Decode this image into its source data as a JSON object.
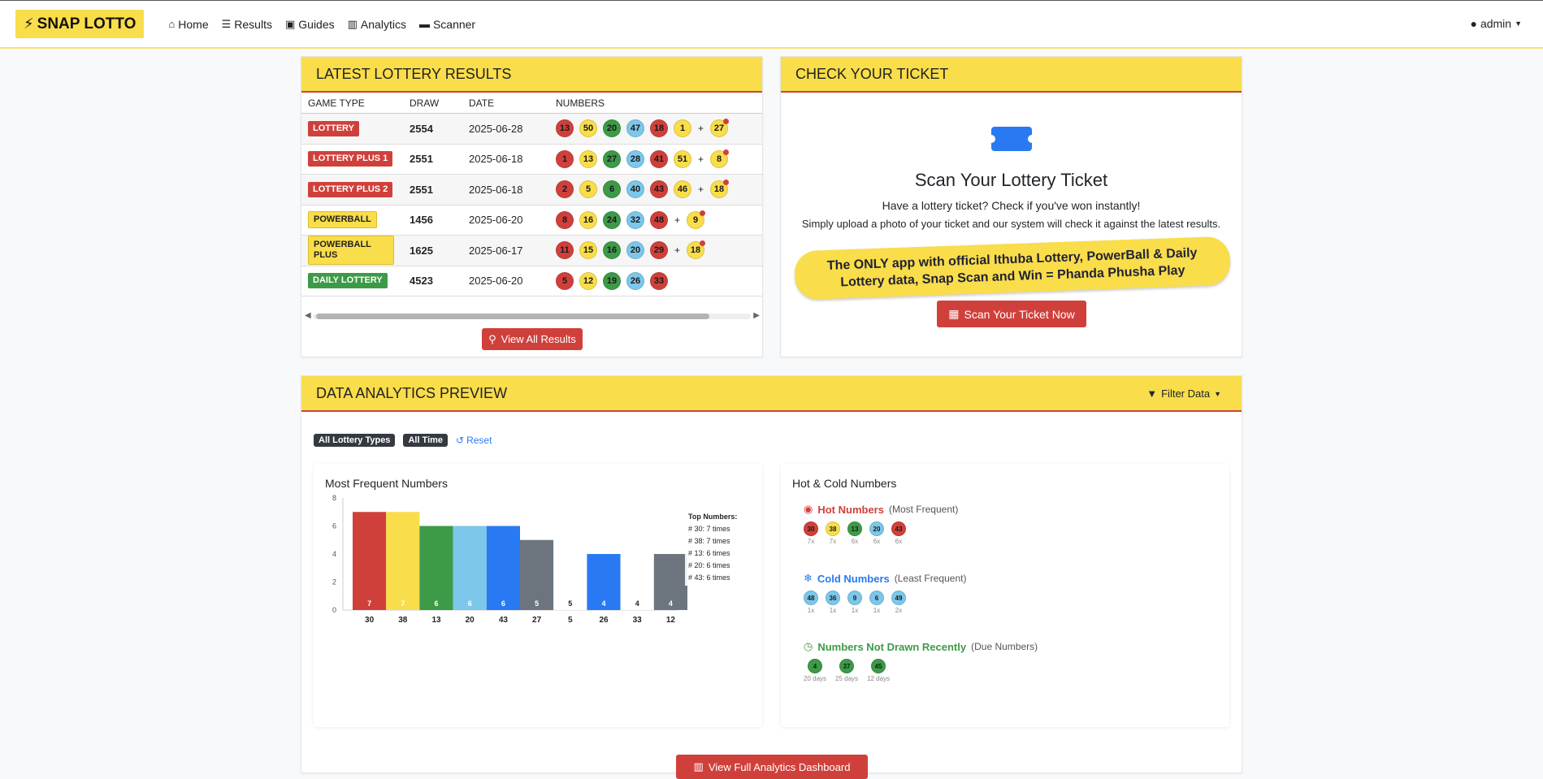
{
  "nav": {
    "brand": "SNAP LOTTO",
    "items": [
      {
        "label": "Home",
        "icon": "home-icon"
      },
      {
        "label": "Results",
        "icon": "list-icon"
      },
      {
        "label": "Guides",
        "icon": "book-icon"
      },
      {
        "label": "Analytics",
        "icon": "chart-icon"
      },
      {
        "label": "Scanner",
        "icon": "ticket-icon"
      }
    ],
    "user": "admin"
  },
  "results": {
    "title": "LATEST LOTTERY RESULTS",
    "columns": [
      "GAME TYPE",
      "DRAW",
      "DATE",
      "NUMBERS"
    ],
    "rows": [
      {
        "type": "LOTTERY",
        "badge_color": "red",
        "draw": "2554",
        "date": "2025-06-28",
        "numbers": [
          {
            "n": "13",
            "c": "red"
          },
          {
            "n": "50",
            "c": "yellow"
          },
          {
            "n": "20",
            "c": "green"
          },
          {
            "n": "47",
            "c": "blue"
          },
          {
            "n": "18",
            "c": "red"
          },
          {
            "n": "1",
            "c": "yellow"
          }
        ],
        "bonus": {
          "n": "27",
          "c": "yellow"
        }
      },
      {
        "type": "LOTTERY PLUS 1",
        "badge_color": "red",
        "draw": "2551",
        "date": "2025-06-18",
        "numbers": [
          {
            "n": "1",
            "c": "red"
          },
          {
            "n": "13",
            "c": "yellow"
          },
          {
            "n": "27",
            "c": "green"
          },
          {
            "n": "28",
            "c": "blue"
          },
          {
            "n": "41",
            "c": "red"
          },
          {
            "n": "51",
            "c": "yellow"
          }
        ],
        "bonus": {
          "n": "8",
          "c": "yellow"
        }
      },
      {
        "type": "LOTTERY PLUS 2",
        "badge_color": "red",
        "draw": "2551",
        "date": "2025-06-18",
        "numbers": [
          {
            "n": "2",
            "c": "red"
          },
          {
            "n": "5",
            "c": "yellow"
          },
          {
            "n": "6",
            "c": "green"
          },
          {
            "n": "40",
            "c": "blue"
          },
          {
            "n": "43",
            "c": "red"
          },
          {
            "n": "46",
            "c": "yellow"
          }
        ],
        "bonus": {
          "n": "18",
          "c": "yellow"
        }
      },
      {
        "type": "POWERBALL",
        "badge_color": "yellow",
        "draw": "1456",
        "date": "2025-06-20",
        "numbers": [
          {
            "n": "8",
            "c": "red"
          },
          {
            "n": "16",
            "c": "yellow"
          },
          {
            "n": "24",
            "c": "green"
          },
          {
            "n": "32",
            "c": "blue"
          },
          {
            "n": "48",
            "c": "red"
          }
        ],
        "bonus": {
          "n": "9",
          "c": "yellow"
        }
      },
      {
        "type": "POWERBALL PLUS",
        "badge_color": "yellow",
        "draw": "1625",
        "date": "2025-06-17",
        "numbers": [
          {
            "n": "11",
            "c": "red"
          },
          {
            "n": "15",
            "c": "yellow"
          },
          {
            "n": "16",
            "c": "green"
          },
          {
            "n": "20",
            "c": "blue"
          },
          {
            "n": "29",
            "c": "red"
          }
        ],
        "bonus": {
          "n": "18",
          "c": "yellow"
        }
      },
      {
        "type": "DAILY LOTTERY",
        "badge_color": "green",
        "draw": "4523",
        "date": "2025-06-20",
        "numbers": [
          {
            "n": "5",
            "c": "red"
          },
          {
            "n": "12",
            "c": "yellow"
          },
          {
            "n": "19",
            "c": "green"
          },
          {
            "n": "26",
            "c": "blue"
          },
          {
            "n": "33",
            "c": "red"
          }
        ],
        "bonus": null
      }
    ],
    "view_all_label": "View All Results"
  },
  "check": {
    "title": "CHECK YOUR TICKET",
    "heading": "Scan Your Lottery Ticket",
    "line1": "Have a lottery ticket? Check if you've won instantly!",
    "line2": "Simply upload a photo of your ticket and our system will check it against the latest results.",
    "promo": "The ONLY app with official Ithuba Lottery, PowerBall & Daily Lottery data, Snap Scan and Win = Phanda Phusha Play",
    "button": "Scan Your Ticket Now"
  },
  "analytics": {
    "title": "DATA ANALYTICS PREVIEW",
    "filter_label": "Filter Data",
    "chips": [
      "All Lottery Types",
      "All Time"
    ],
    "reset_label": "Reset",
    "freq_title": "Most Frequent Numbers",
    "tooltip_title": "Top Numbers:",
    "tooltip_lines": [
      "# 30: 7 times",
      "# 38: 7 times",
      "# 13: 6 times",
      "# 20: 6 times",
      "# 43: 6 times"
    ],
    "hc_title": "Hot & Cold Numbers",
    "hot": {
      "label": "Hot Numbers",
      "sub": "(Most Frequent)",
      "balls": [
        {
          "n": "30",
          "c": "red",
          "s": "7x"
        },
        {
          "n": "38",
          "c": "yellow",
          "s": "7x"
        },
        {
          "n": "13",
          "c": "green",
          "s": "6x"
        },
        {
          "n": "20",
          "c": "blue",
          "s": "6x"
        },
        {
          "n": "43",
          "c": "red",
          "s": "6x"
        }
      ]
    },
    "cold": {
      "label": "Cold Numbers",
      "sub": "(Least Frequent)",
      "balls": [
        {
          "n": "48",
          "c": "blue",
          "s": "1x"
        },
        {
          "n": "36",
          "c": "blue",
          "s": "1x"
        },
        {
          "n": "9",
          "c": "blue",
          "s": "1x"
        },
        {
          "n": "6",
          "c": "blue",
          "s": "1x"
        },
        {
          "n": "49",
          "c": "blue",
          "s": "2x"
        }
      ]
    },
    "due": {
      "label": "Numbers Not Drawn Recently",
      "sub": "(Due Numbers)",
      "balls": [
        {
          "n": "4",
          "c": "green",
          "s": "20 days"
        },
        {
          "n": "37",
          "c": "green",
          "s": "25 days"
        },
        {
          "n": "45",
          "c": "green",
          "s": "12 days"
        }
      ]
    },
    "dashboard_button": "View Full Analytics Dashboard"
  },
  "chart_data": {
    "type": "bar",
    "categories": [
      "30",
      "38",
      "13",
      "20",
      "43",
      "27",
      "5",
      "26",
      "33",
      "12"
    ],
    "values": [
      7,
      7,
      6,
      6,
      6,
      5,
      5,
      4,
      4,
      4
    ],
    "colors": [
      "#d0403b",
      "#f9dd4a",
      "#3d9a47",
      "#7cc7ea",
      "#2979f2",
      "#6c757d",
      "#ffffff",
      "#2979f2",
      "#ffffff",
      "#6c757d"
    ],
    "yticks": [
      "0",
      "2",
      "4",
      "6",
      "8"
    ],
    "ylim": [
      0,
      8
    ],
    "title": "Most Frequent Numbers",
    "grid": false
  }
}
